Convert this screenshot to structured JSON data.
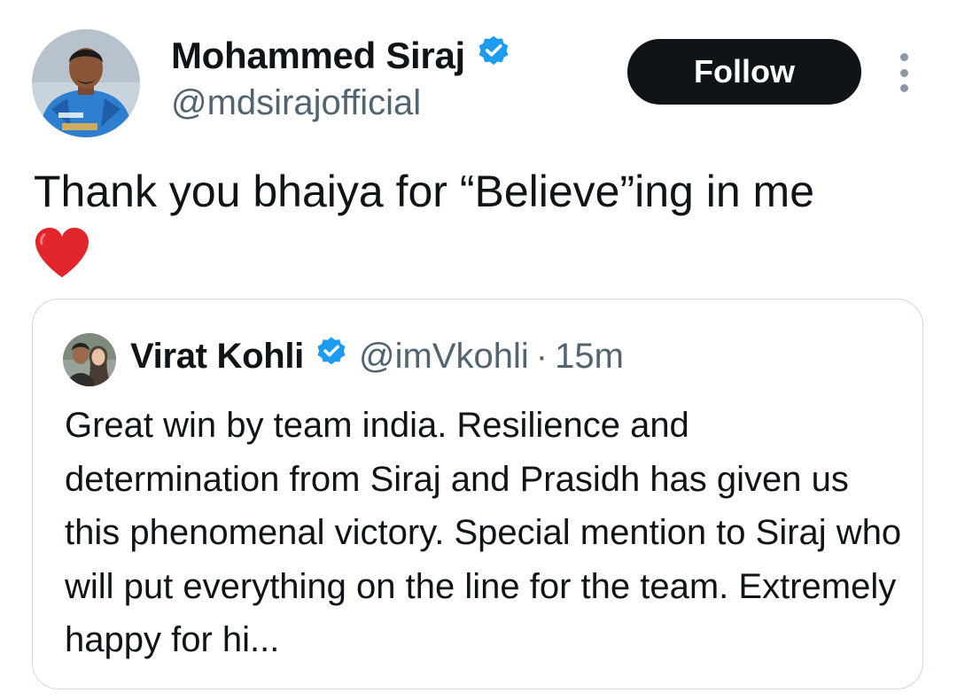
{
  "tweet": {
    "author": {
      "name": "Mohammed Siraj",
      "handle": "@mdsirajofficial",
      "verified": true,
      "avatar_icon": "avatar"
    },
    "follow_label": "Follow",
    "more_icon": "more-options-icon",
    "text": "Thank you bhaiya for “Believe”ing in me",
    "emoji": "heart-emoji"
  },
  "quote": {
    "author": {
      "name": "Virat Kohli",
      "handle": "@imVkohli",
      "verified": true
    },
    "separator": "·",
    "time": "15m",
    "text": "Great win by team india. Resilience and determination from Siraj and Prasidh has given us this phenomenal victory. Special mention to Siraj who will put everything on the line for the team. Extremely happy for hi..."
  },
  "colors": {
    "text_primary": "#0f1419",
    "text_secondary": "#536471",
    "verified_blue": "#1d9bf0",
    "follow_bg": "#0f1419",
    "border": "#cfd9de",
    "heart_red": "#e0252b"
  }
}
